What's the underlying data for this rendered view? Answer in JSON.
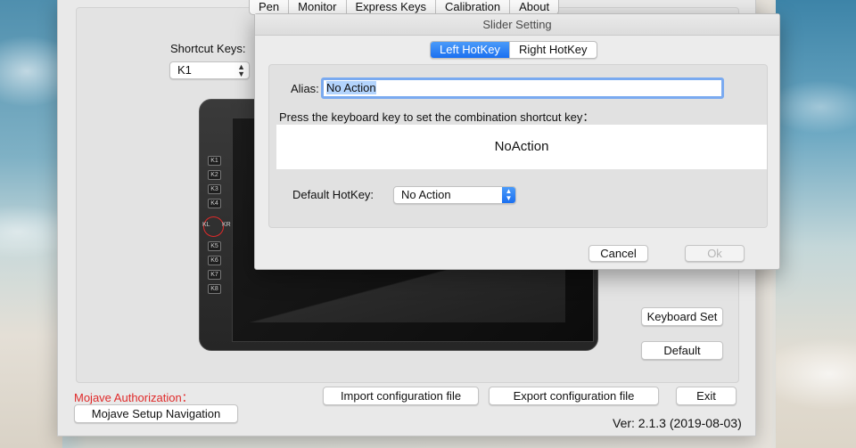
{
  "main_tabs": [
    "Pen",
    "Monitor",
    "Express Keys",
    "Calibration",
    "About"
  ],
  "shortcut": {
    "label": "Shortcut Keys:",
    "selected": "K1"
  },
  "tablet_keys": [
    "K1",
    "K2",
    "K3",
    "K4",
    "K5",
    "K6",
    "K7",
    "K8"
  ],
  "dial_labels": {
    "left": "KL",
    "right": "KR"
  },
  "buttons": {
    "keyboard_set": "Keyboard Set",
    "default": "Default",
    "import": "Import configuration file",
    "export": "Export configuration file",
    "exit": "Exit",
    "mojave_nav": "Mojave Setup Navigation"
  },
  "mojave_auth": "Mojave Authorization：",
  "version": "Ver: 2.1.3 (2019-08-03)",
  "dialog": {
    "title": "Slider Setting",
    "segments": [
      "Left HotKey",
      "Right HotKey"
    ],
    "alias_label": "Alias:",
    "alias_value": "No Action",
    "instruction": "Press the keyboard key to set the combination shortcut key：",
    "combination": "NoAction",
    "default_hotkey_label": "Default HotKey:",
    "default_hotkey_value": "No Action",
    "cancel": "Cancel",
    "ok": "Ok"
  },
  "colors": {
    "accent": "#1a6ff0",
    "warning_text": "#e02a2a"
  }
}
